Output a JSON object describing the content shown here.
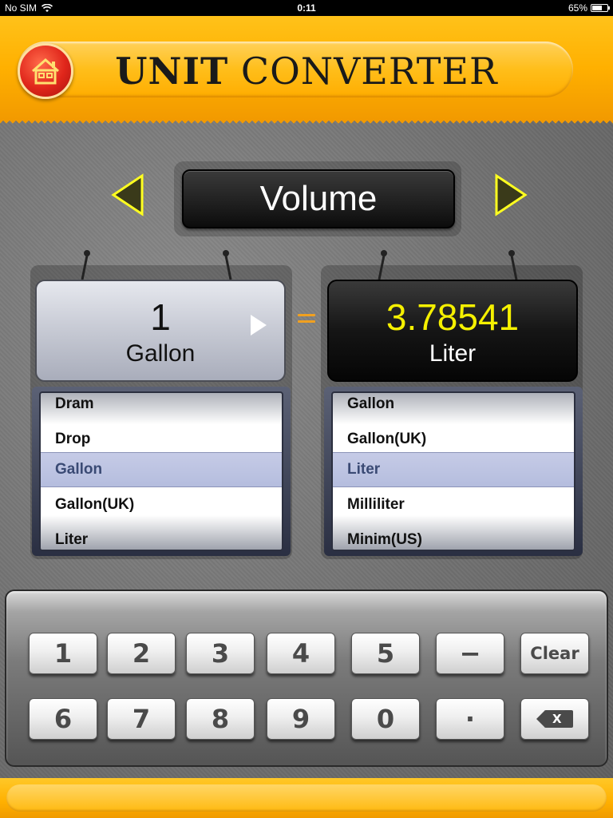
{
  "status_bar": {
    "carrier": "No SIM",
    "time": "0:11",
    "battery": "65%",
    "battery_level": 0.65
  },
  "header": {
    "title_bold": "UNIT",
    "title_rest": "CONVERTER",
    "home_icon": "house-icon"
  },
  "category": {
    "label": "Volume",
    "prev_icon": "triangle-left-icon",
    "next_icon": "triangle-right-icon"
  },
  "from": {
    "value": "1",
    "unit": "Gallon",
    "picker_items": [
      "Dram",
      "Drop",
      "Gallon",
      "Gallon(UK)",
      "Liter"
    ],
    "selected_index": 2
  },
  "to": {
    "value": "3.78541",
    "unit": "Liter",
    "picker_items": [
      "Gallon",
      "Gallon(UK)",
      "Liter",
      "Milliliter",
      "Minim(US)"
    ],
    "selected_index": 2
  },
  "keypad": {
    "row1": [
      "1",
      "2",
      "3",
      "4",
      "5",
      "−",
      "Clear"
    ],
    "row2": [
      "6",
      "7",
      "8",
      "9",
      "0",
      "·"
    ],
    "backspace_label": "X"
  },
  "colors": {
    "accent_orange": "#ffb000",
    "result_yellow": "#f5f000",
    "home_red": "#e0261b"
  }
}
